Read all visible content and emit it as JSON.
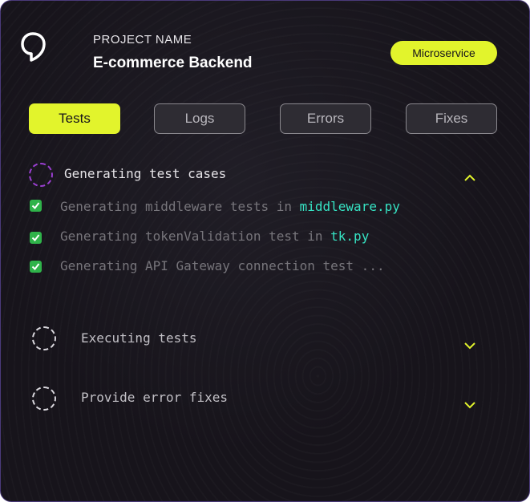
{
  "project": {
    "label": "PROJECT NAME",
    "name": "E-commerce Backend",
    "badge": "Microservice"
  },
  "tabs": [
    {
      "label": "Tests",
      "active": true
    },
    {
      "label": "Logs",
      "active": false
    },
    {
      "label": "Errors",
      "active": false
    },
    {
      "label": "Fixes",
      "active": false
    }
  ],
  "sections": [
    {
      "title": "Generating test cases",
      "expanded": true,
      "items": [
        {
          "text": "Generating middleware tests in ",
          "highlight": "middleware.py"
        },
        {
          "text": "Generating tokenValidation test in ",
          "highlight": "tk.py"
        },
        {
          "text": "Generating API Gateway connection test ...",
          "highlight": ""
        }
      ]
    },
    {
      "title": "Executing tests",
      "expanded": false
    },
    {
      "title": "Provide error fixes",
      "expanded": false
    }
  ],
  "colors": {
    "accent": "#e2f42c",
    "background": "#17141b",
    "highlight": "#36e3c3",
    "active_ring": "#9a3fd0",
    "check": "#2fb34a"
  },
  "icons": {
    "logo": "speech-bubble-logo-icon",
    "check": "check-box-icon",
    "collapse": "chevron-up-icon",
    "expand": "chevron-down-icon",
    "pending": "dashed-circle-icon"
  }
}
